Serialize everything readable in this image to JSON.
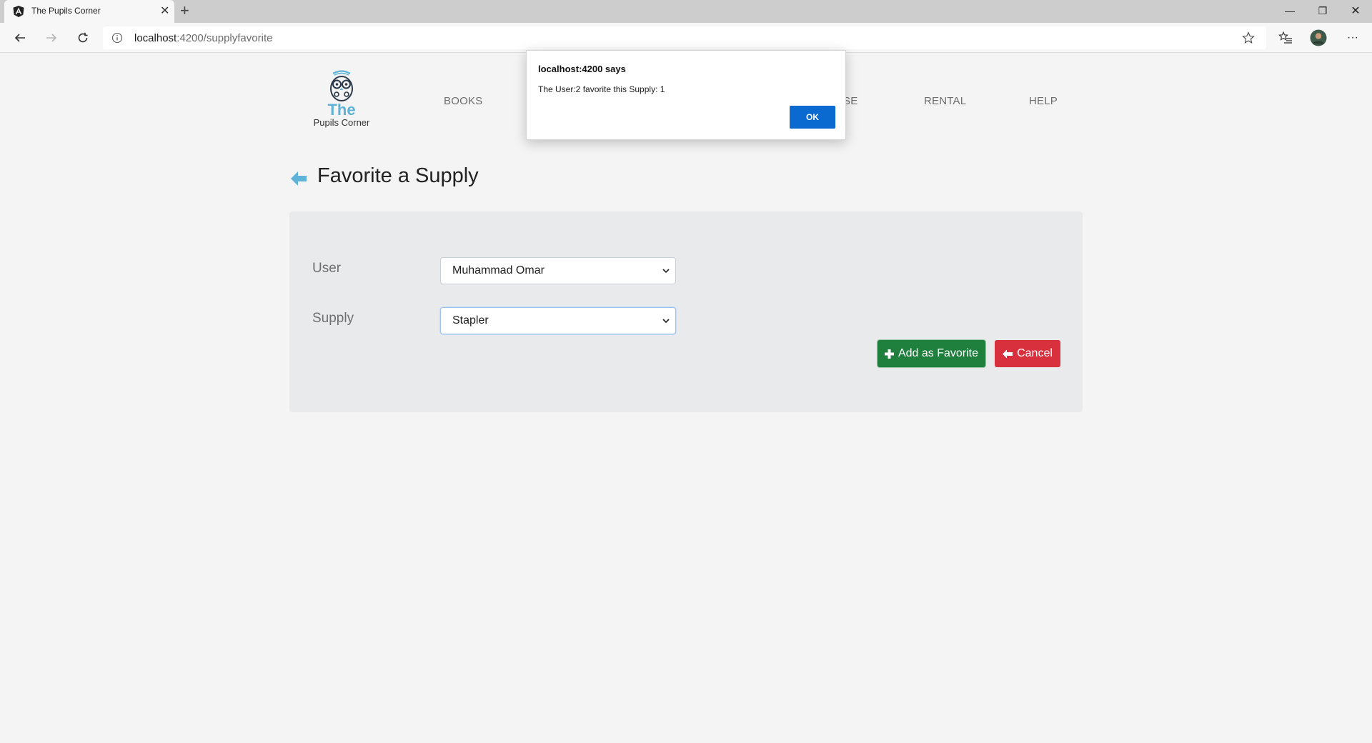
{
  "browser": {
    "tab_title": "The Pupils Corner",
    "tab_close": "✕",
    "new_tab": "+",
    "url_host": "localhost",
    "url_path": ":4200/supplyfavorite",
    "window_controls": {
      "minimize": "—",
      "restore": "❐",
      "close": "✕"
    },
    "more_menu": "···"
  },
  "header": {
    "logo_the": "The",
    "logo_subtitle": "Pupils Corner",
    "nav": [
      {
        "label": "BOOKS"
      },
      {
        "label": "SE"
      },
      {
        "label": "RENTAL"
      },
      {
        "label": "HELP"
      }
    ]
  },
  "main": {
    "title": "Favorite a Supply",
    "form": {
      "user_label": "User",
      "user_value": "Muhammad Omar",
      "supply_label": "Supply",
      "supply_value": "Stapler",
      "add_button": "Add as Favorite",
      "cancel_button": "Cancel"
    }
  },
  "dialog": {
    "title": "localhost:4200 says",
    "message": "The User:2 favorite this Supply: 1",
    "ok": "OK"
  },
  "colors": {
    "accent_blue": "#5fb3d9",
    "success_green": "#1f7f3c",
    "danger_red": "#d9303e",
    "dialog_ok_blue": "#0a6ad0"
  },
  "icons": [
    "angular-favicon-icon",
    "back-icon",
    "forward-icon",
    "refresh-icon",
    "info-icon",
    "favorite-star-icon",
    "favorites-list-icon",
    "profile-avatar-icon",
    "owl-logo-icon",
    "arrow-left-icon",
    "plus-icon"
  ]
}
